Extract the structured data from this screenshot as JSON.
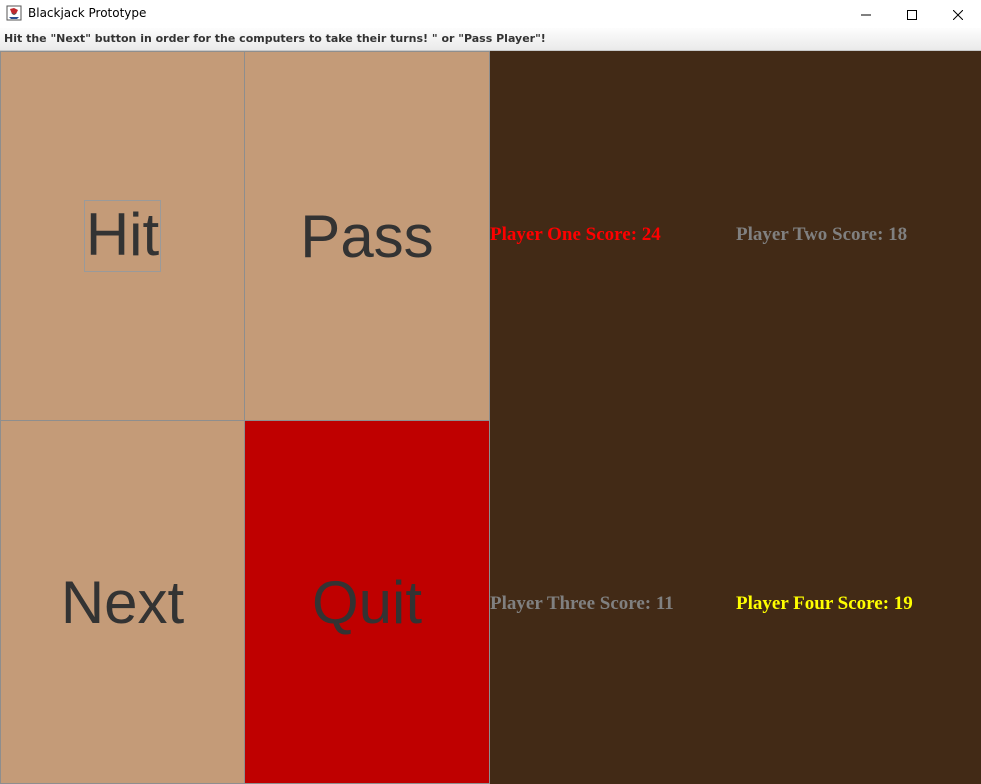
{
  "window": {
    "title": "Blackjack Prototype"
  },
  "instruction": {
    "text": "Hit the \"Next\" button in order for the computers to take their turns!  \" or \"Pass Player\"!"
  },
  "buttons": {
    "hit": "Hit",
    "pass": "Pass",
    "next": "Next",
    "quit": "Quit"
  },
  "scores": {
    "player_one": {
      "label": "Player One Score: 24",
      "color": "#ff0000"
    },
    "player_two": {
      "label": "Player Two Score: 18",
      "color": "#808080"
    },
    "player_three": {
      "label": "Player Three Score: 11",
      "color": "#808080"
    },
    "player_four": {
      "label": "Player Four Score: 19",
      "color": "#ffff00"
    }
  },
  "colors": {
    "table_background": "#422a16",
    "button_tan": "#c49b78",
    "quit_red": "#bf0000"
  },
  "icons": {
    "app": "java-cup-icon",
    "minimize": "minimize-icon",
    "maximize": "maximize-icon",
    "close": "close-icon"
  }
}
